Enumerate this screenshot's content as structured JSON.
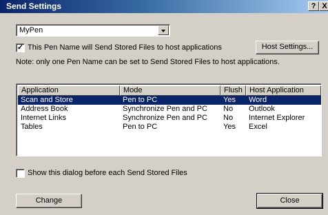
{
  "window": {
    "title": "Send Settings",
    "help_button": "?",
    "close_button": "X"
  },
  "pen_name": {
    "selected": "MyPen"
  },
  "send_checkbox": {
    "checked": true,
    "label": "This Pen Name will Send Stored Files to host applications"
  },
  "host_settings_label": "Host Settings...",
  "note": "Note: only one Pen Name can be set to Send Stored Files to host applications.",
  "table": {
    "columns": [
      "Application",
      "Mode",
      "Flush",
      "Host Application"
    ],
    "rows": [
      {
        "application": "Scan and Store",
        "mode": "Pen to PC",
        "flush": "Yes",
        "host": "Word",
        "selected": true
      },
      {
        "application": "Address Book",
        "mode": "Synchronize Pen and PC",
        "flush": "No",
        "host": "Outlook",
        "selected": false
      },
      {
        "application": "Internet Links",
        "mode": "Synchronize Pen and PC",
        "flush": "No",
        "host": "Internet Explorer",
        "selected": false
      },
      {
        "application": "Tables",
        "mode": "Pen to PC",
        "flush": "Yes",
        "host": "Excel",
        "selected": false
      }
    ]
  },
  "show_dialog_checkbox": {
    "checked": false,
    "label": "Show this dialog before each Send Stored Files"
  },
  "buttons": {
    "change": "Change",
    "close": "Close"
  },
  "colors": {
    "titlebar_start": "#0a246a",
    "titlebar_end": "#a6caf0",
    "selection": "#0a246a",
    "dialog_face": "#d4d0c8"
  }
}
